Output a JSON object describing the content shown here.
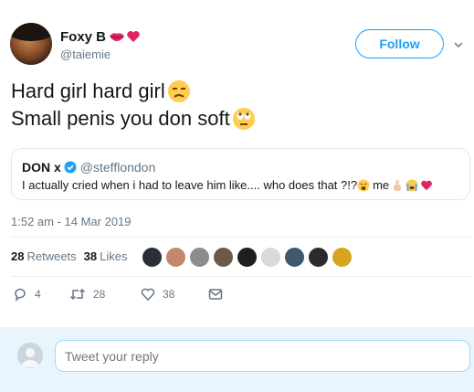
{
  "author": {
    "display_name": "Foxy B",
    "handle": "@taiemie",
    "name_emojis": [
      "lips-emoji",
      "heart-emoji"
    ]
  },
  "follow_button": {
    "label": "Follow"
  },
  "tweet": {
    "lines": [
      {
        "text": "Hard girl hard girl",
        "emoji": "unamused-face-emoji"
      },
      {
        "text": "Small penis you don soft",
        "emoji": "rolling-eyes-emoji"
      }
    ],
    "timestamp": "1:52 am - 14 Mar 2019"
  },
  "quoted_tweet": {
    "display_name": "DON x",
    "handle": "@stefflondon",
    "text": "I actually cried when i had to leave him like.... who does that ?!?",
    "text_after_emoji": "me"
  },
  "stats": {
    "retweets_count": "28",
    "retweets_label": "Retweets",
    "likes_count": "38",
    "likes_label": "Likes"
  },
  "actions": {
    "replies": "4",
    "retweets": "28",
    "likes": "38"
  },
  "reply": {
    "placeholder": "Tweet your reply"
  },
  "colors": {
    "accent": "#1da1f2",
    "secondary_text": "#657786",
    "primary_text": "#14171a",
    "reply_bg": "#e8f5fd"
  }
}
